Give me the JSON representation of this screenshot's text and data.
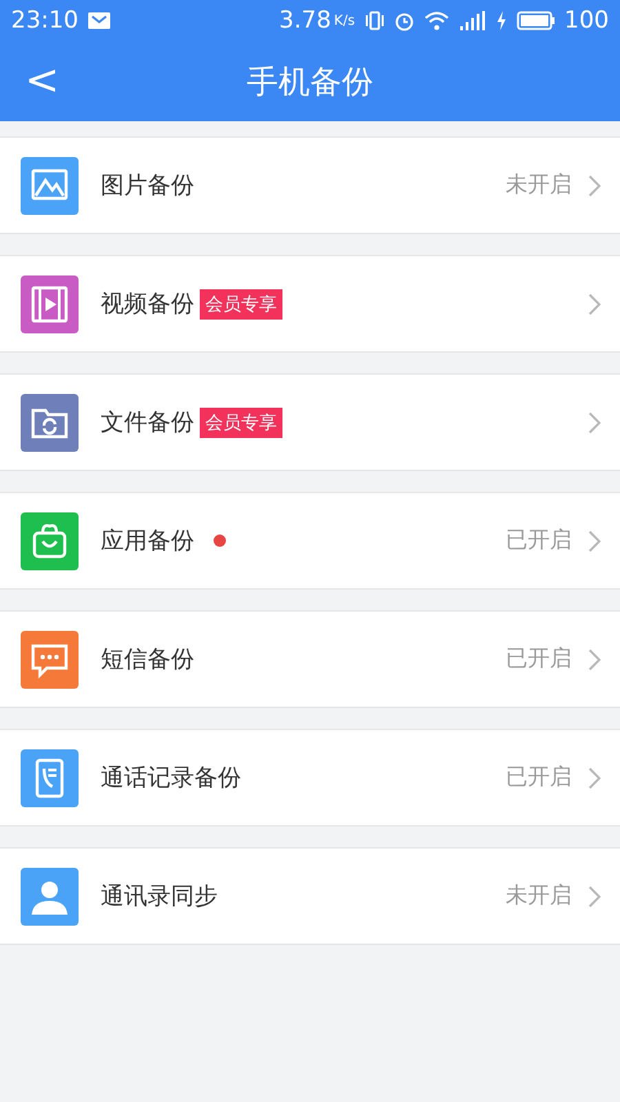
{
  "status_bar": {
    "time": "23:10",
    "speed": "3.78",
    "speed_unit": "K/s",
    "battery": "100"
  },
  "header": {
    "back": "<",
    "title": "手机备份"
  },
  "items": [
    {
      "kind": "picture",
      "color": "#4ba3f7",
      "label": "图片备份",
      "status": "未开启",
      "dot": false
    },
    {
      "kind": "video",
      "color": "#c95bc4",
      "label": "视频备份",
      "badge": "会员专享",
      "dot": false
    },
    {
      "kind": "folder",
      "color": "#6e7fb9",
      "label": "文件备份",
      "badge": "会员专享",
      "dot": false
    },
    {
      "kind": "bag",
      "color": "#1fbf4f",
      "label": "应用备份",
      "status": "已开启",
      "dot": true
    },
    {
      "kind": "chat",
      "color": "#f57a3a",
      "label": "短信备份",
      "status": "已开启",
      "dot": false
    },
    {
      "kind": "phone",
      "color": "#4ba3f7",
      "label": "通话记录备份",
      "status": "已开启",
      "dot": false
    },
    {
      "kind": "person",
      "color": "#4ba3f7",
      "label": "通讯录同步",
      "status": "未开启",
      "dot": false
    }
  ]
}
